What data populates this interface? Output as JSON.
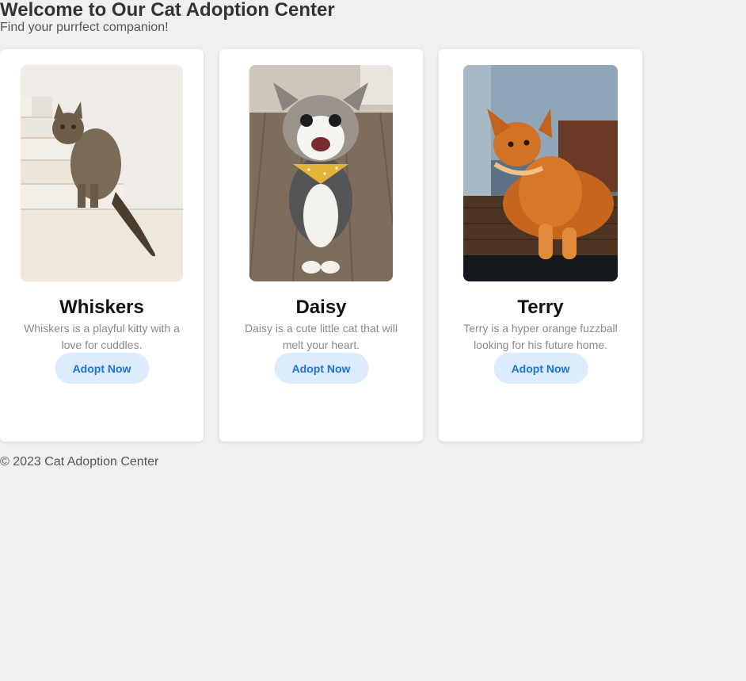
{
  "header": {
    "title": "Welcome to Our Cat Adoption Center",
    "subtitle": "Find your purrfect companion!"
  },
  "cats": [
    {
      "name": "Whiskers",
      "description": "Whiskers is a playful kitty with a love for cuddles.",
      "button_label": "Adopt Now",
      "photo_icon": "tabby-cat-on-stairs-photo"
    },
    {
      "name": "Daisy",
      "description": "Daisy is a cute little cat that will melt your heart.",
      "button_label": "Adopt Now",
      "photo_icon": "smiling-cat-with-bandana-photo"
    },
    {
      "name": "Terry",
      "description": "Terry is a hyper orange fuzzball looking for his future home.",
      "button_label": "Adopt Now",
      "photo_icon": "orange-fluffy-cat-photo"
    }
  ],
  "footer": {
    "text": "© 2023 Cat Adoption Center"
  },
  "colors": {
    "background": "#f0f0f0",
    "card": "#ffffff",
    "button_bg": "#dcecfc",
    "button_text": "#1a73d9"
  }
}
